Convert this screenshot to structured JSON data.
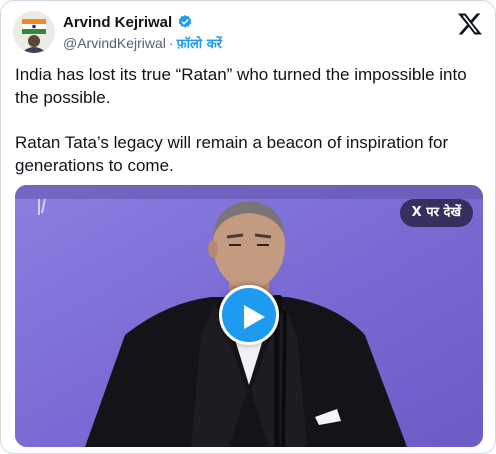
{
  "author": {
    "display_name": "Arvind Kejriwal",
    "handle": "@ArvindKejriwal",
    "separator": "·",
    "follow_label": "फ़ॉलो करें",
    "verified": true,
    "verified_color": "#1d9bf0"
  },
  "tweet": {
    "paragraphs": [
      "India has lost its true “Ratan” who turned the impossible into the possible.",
      "Ratan Tata’s legacy will remain a beacon of inspiration for generations to come."
    ]
  },
  "media": {
    "watch_on_x_label": "X पर देखें",
    "play_button_color": "#1d9bf0",
    "background_color": "#7d6fd2"
  },
  "icons": {
    "platform_logo": "x-logo-icon",
    "verified_badge": "verified-badge-icon",
    "play": "play-icon"
  }
}
